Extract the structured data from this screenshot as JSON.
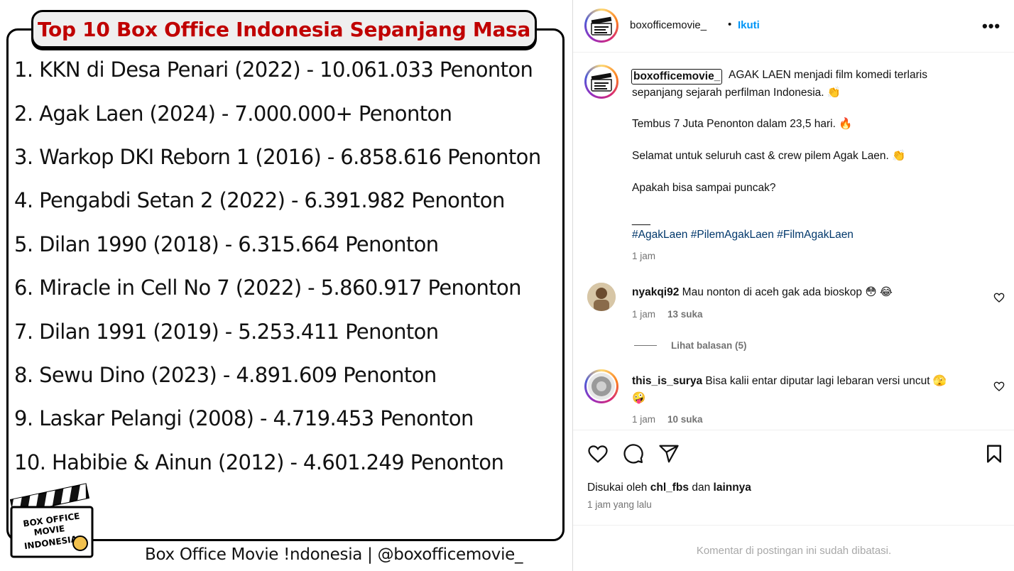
{
  "image": {
    "title": "Top 10 Box Office Indonesia Sepanjang Masa",
    "rankings": [
      "1. KKN di Desa Penari (2022) - 10.061.033 Penonton",
      "2. Agak Laen (2024) - 7.000.000+ Penonton",
      "3. Warkop DKI Reborn 1 (2016) - 6.858.616 Penonton",
      "4. Pengabdi Setan 2 (2022) - 6.391.982 Penonton",
      "5. Dilan 1990 (2018) - 6.315.664 Penonton",
      "6. Miracle in Cell No 7 (2022) - 5.860.917 Penonton",
      "7. Dilan 1991 (2019) - 5.253.411 Penonton",
      "8. Sewu Dino (2023) - 4.891.609 Penonton",
      "9. Laskar Pelangi (2008) - 4.719.453 Penonton",
      "10. Habibie & Ainun (2012) - 4.601.249 Penonton"
    ],
    "logo_text": [
      "BOX OFFICE",
      "MOVIE",
      "INDONESIA"
    ],
    "footer": "Box Office Movie !ndonesia  |  @boxofficemovie_"
  },
  "header": {
    "username": "boxofficemovie_",
    "separator": "•",
    "follow_label": "Ikuti",
    "more_icon": "more-options-icon"
  },
  "caption": {
    "username": "boxofficemovie_",
    "line1": "AGAK LAEN menjadi film komedi terlaris",
    "line2": "sepanjang sejarah perfilman Indonesia. 👏",
    "line3": "Tembus 7 Juta Penonton dalam 23,5 hari. 🔥",
    "line4": "Selamat untuk seluruh cast & crew pilem Agak Laen. 👏",
    "line5": "Apakah bisa sampai puncak?",
    "divider": "___",
    "hashtags": "#AgakLaen #PilemAgakLaen #FilmAgakLaen",
    "time": "1 jam"
  },
  "comments": [
    {
      "username": "nyakqi92",
      "text": "Mau nonton di aceh gak ada bioskop 😳 😂",
      "time": "1 jam",
      "likes": "13 suka",
      "replies": "Lihat balasan (5)"
    },
    {
      "username": "this_is_surya",
      "text_line1": "Bisa kalii entar diputar lagi lebaran versi uncut 🫣",
      "text_line2": "🤪",
      "time": "1 jam",
      "likes": "10 suka"
    }
  ],
  "actions": {
    "like_icon": "heart-icon",
    "comment_icon": "comment-icon",
    "share_icon": "share-icon",
    "save_icon": "bookmark-icon",
    "liked_prefix": "Disukai oleh",
    "liked_user": "chl_fbs",
    "liked_middle": "dan",
    "liked_suffix": "lainnya",
    "time_ago": "1 jam yang lalu"
  },
  "comments_disabled": "Komentar di postingan ini sudah dibatasi.",
  "colors": {
    "title_red": "#c00000",
    "follow_blue": "#0095f6",
    "hashtag_blue": "#00376b",
    "muted_gray": "#737373"
  }
}
